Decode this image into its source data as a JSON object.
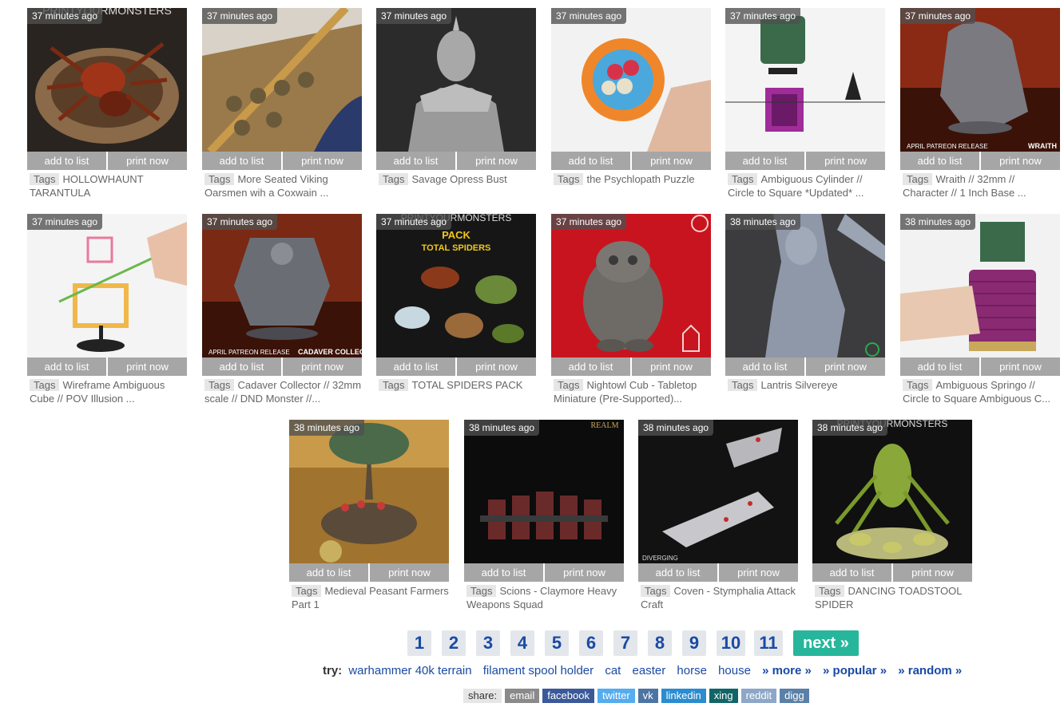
{
  "labels": {
    "tag": "Tags",
    "add": "add to list",
    "print": "print now"
  },
  "cards": [
    {
      "age": "37 minutes ago",
      "title": "HOLLOWHAUNT TARANTULA"
    },
    {
      "age": "37 minutes ago",
      "title": "More Seated Viking Oarsmen wih a Coxwain ..."
    },
    {
      "age": "37 minutes ago",
      "title": "Savage Opress Bust"
    },
    {
      "age": "37 minutes ago",
      "title": "the Psychlopath Puzzle"
    },
    {
      "age": "37 minutes ago",
      "title": "Ambiguous Cylinder // Circle to Square *Updated* ..."
    },
    {
      "age": "37 minutes ago",
      "title": "Wraith // 32mm // Character // 1 Inch Base ..."
    },
    {
      "age": "37 minutes ago",
      "title": "Wireframe Ambiguous Cube // POV Illusion ..."
    },
    {
      "age": "37 minutes ago",
      "title": "Cadaver Collector // 32mm scale // DND Monster //..."
    },
    {
      "age": "37 minutes ago",
      "title": "TOTAL SPIDERS PACK"
    },
    {
      "age": "37 minutes ago",
      "title": "Nightowl Cub - Tabletop Miniature (Pre-Supported)..."
    },
    {
      "age": "38 minutes ago",
      "title": "Lantris Silvereye"
    },
    {
      "age": "38 minutes ago",
      "title": "Ambiguous Springo // Circle to Square Ambiguous C..."
    },
    {
      "age": "38 minutes ago",
      "title": "Medieval Peasant Farmers Part 1"
    },
    {
      "age": "38 minutes ago",
      "title": "Scions - Claymore Heavy Weapons Squad"
    },
    {
      "age": "38 minutes ago",
      "title": "Coven - Stymphalia Attack Craft"
    },
    {
      "age": "38 minutes ago",
      "title": "DANCING TOADSTOOL SPIDER"
    }
  ],
  "image_text": {
    "printyourmonsters": "PRINTYOURMONSTERS",
    "april_patreon": "APRIL PATREON RELEASE",
    "wraith": "WRAITH",
    "cadaver_collector": "CADAVER COLLECTOR",
    "pack": "PACK",
    "total_spiders": "TOTAL SPIDERS",
    "realm": "REALM",
    "diverging": "DIVERGING"
  },
  "pagination": [
    "1",
    "2",
    "3",
    "4",
    "5",
    "6",
    "7",
    "8",
    "9",
    "10",
    "11"
  ],
  "next_label": "next »",
  "try": {
    "label": "try:",
    "links": [
      "warhammer 40k terrain",
      "filament spool holder",
      "cat",
      "easter",
      "horse",
      "house"
    ],
    "more": "» more »",
    "popular": "» popular »",
    "random": "» random »"
  },
  "share": {
    "label": "share:",
    "items": [
      {
        "name": "email",
        "color": "#8a8a8a"
      },
      {
        "name": "facebook",
        "color": "#3b5998"
      },
      {
        "name": "twitter",
        "color": "#55acee"
      },
      {
        "name": "vk",
        "color": "#4c75a3"
      },
      {
        "name": "linkedin",
        "color": "#2b8ccf"
      },
      {
        "name": "xing",
        "color": "#126567"
      },
      {
        "name": "reddit",
        "color": "#8ea7c8"
      },
      {
        "name": "digg",
        "color": "#5a80a8"
      }
    ]
  },
  "colors": {
    "accent": "#27b69c",
    "link": "#1a4aa5",
    "button": "#a6a6a6"
  }
}
